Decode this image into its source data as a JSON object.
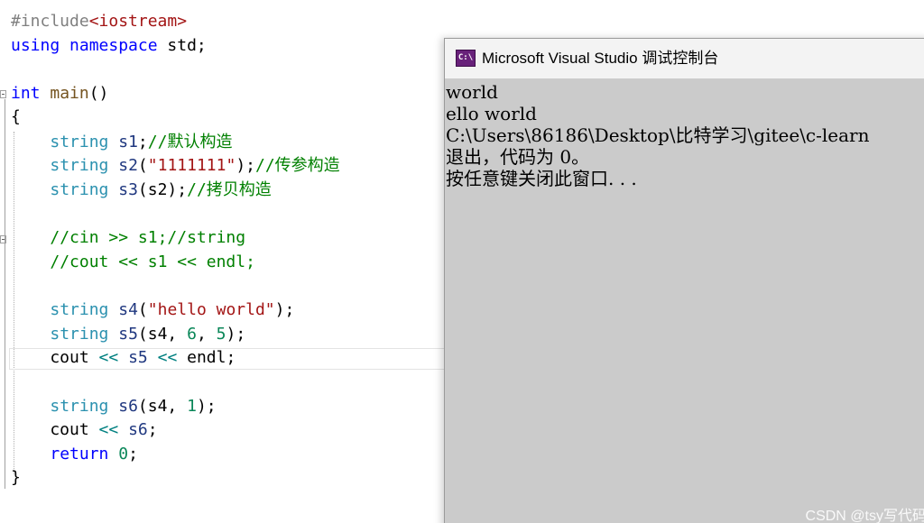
{
  "editor": {
    "lines": [
      [
        {
          "t": "pp",
          "s": "#include"
        },
        {
          "t": "hdr",
          "s": "<iostream>"
        }
      ],
      [
        {
          "t": "kw",
          "s": "using"
        },
        {
          "t": "plain",
          "s": " "
        },
        {
          "t": "kw",
          "s": "namespace"
        },
        {
          "t": "plain",
          "s": " std;"
        }
      ],
      [],
      [
        {
          "t": "kw",
          "s": "int"
        },
        {
          "t": "plain",
          "s": " "
        },
        {
          "t": "fn",
          "s": "main"
        },
        {
          "t": "plain",
          "s": "()"
        }
      ],
      [
        {
          "t": "plain",
          "s": "{"
        }
      ],
      [
        {
          "t": "plain",
          "s": "    "
        },
        {
          "t": "type",
          "s": "string"
        },
        {
          "t": "plain",
          "s": " "
        },
        {
          "t": "id",
          "s": "s1"
        },
        {
          "t": "plain",
          "s": ";"
        },
        {
          "t": "cmt",
          "s": "//默认构造"
        }
      ],
      [
        {
          "t": "plain",
          "s": "    "
        },
        {
          "t": "type",
          "s": "string"
        },
        {
          "t": "plain",
          "s": " "
        },
        {
          "t": "id",
          "s": "s2"
        },
        {
          "t": "plain",
          "s": "("
        },
        {
          "t": "str",
          "s": "\"1111111\""
        },
        {
          "t": "plain",
          "s": ");"
        },
        {
          "t": "cmt",
          "s": "//传参构造"
        }
      ],
      [
        {
          "t": "plain",
          "s": "    "
        },
        {
          "t": "type",
          "s": "string"
        },
        {
          "t": "plain",
          "s": " "
        },
        {
          "t": "id",
          "s": "s3"
        },
        {
          "t": "plain",
          "s": "(s2);"
        },
        {
          "t": "cmt",
          "s": "//拷贝构造"
        }
      ],
      [],
      [
        {
          "t": "plain",
          "s": "    "
        },
        {
          "t": "cmt",
          "s": "//cin >> s1;//string"
        }
      ],
      [
        {
          "t": "plain",
          "s": "    "
        },
        {
          "t": "cmt",
          "s": "//cout << s1 << endl;"
        }
      ],
      [],
      [
        {
          "t": "plain",
          "s": "    "
        },
        {
          "t": "type",
          "s": "string"
        },
        {
          "t": "plain",
          "s": " "
        },
        {
          "t": "id",
          "s": "s4"
        },
        {
          "t": "plain",
          "s": "("
        },
        {
          "t": "str",
          "s": "\"hello world\""
        },
        {
          "t": "plain",
          "s": ");"
        }
      ],
      [
        {
          "t": "plain",
          "s": "    "
        },
        {
          "t": "type",
          "s": "string"
        },
        {
          "t": "plain",
          "s": " "
        },
        {
          "t": "id",
          "s": "s5"
        },
        {
          "t": "plain",
          "s": "(s4, "
        },
        {
          "t": "num",
          "s": "6"
        },
        {
          "t": "plain",
          "s": ", "
        },
        {
          "t": "num",
          "s": "5"
        },
        {
          "t": "plain",
          "s": ");"
        }
      ],
      [
        {
          "t": "plain",
          "s": "    cout "
        },
        {
          "t": "op",
          "s": "<<"
        },
        {
          "t": "plain",
          "s": " "
        },
        {
          "t": "id",
          "s": "s5"
        },
        {
          "t": "plain",
          "s": " "
        },
        {
          "t": "op",
          "s": "<<"
        },
        {
          "t": "plain",
          "s": " endl;"
        }
      ],
      [],
      [
        {
          "t": "plain",
          "s": "    "
        },
        {
          "t": "type",
          "s": "string"
        },
        {
          "t": "plain",
          "s": " "
        },
        {
          "t": "id",
          "s": "s6"
        },
        {
          "t": "plain",
          "s": "(s4, "
        },
        {
          "t": "num",
          "s": "1"
        },
        {
          "t": "plain",
          "s": ");"
        }
      ],
      [
        {
          "t": "plain",
          "s": "    cout "
        },
        {
          "t": "op",
          "s": "<<"
        },
        {
          "t": "plain",
          "s": " "
        },
        {
          "t": "id",
          "s": "s6"
        },
        {
          "t": "plain",
          "s": ";"
        }
      ],
      [
        {
          "t": "plain",
          "s": "    "
        },
        {
          "t": "kw",
          "s": "return"
        },
        {
          "t": "plain",
          "s": " "
        },
        {
          "t": "num",
          "s": "0"
        },
        {
          "t": "plain",
          "s": ";"
        }
      ],
      [
        {
          "t": "plain",
          "s": "}"
        }
      ]
    ]
  },
  "console": {
    "title": "Microsoft Visual Studio 调试控制台",
    "icon": "console-app-icon",
    "icon_text": "C:\\",
    "output_lines": [
      "world",
      "ello world",
      "C:\\Users\\86186\\Desktop\\比特学习\\gitee\\c-learn",
      "退出，代码为 0。",
      "按任意键关闭此窗口. . ."
    ]
  },
  "watermark": "CSDN @tsy写代码",
  "colors": {
    "keyword": "#0000ff",
    "type": "#2b91af",
    "comment": "#008000",
    "string": "#a31515",
    "console_bg": "#cbcbcb",
    "titlebar_bg": "#f3f3f3"
  }
}
